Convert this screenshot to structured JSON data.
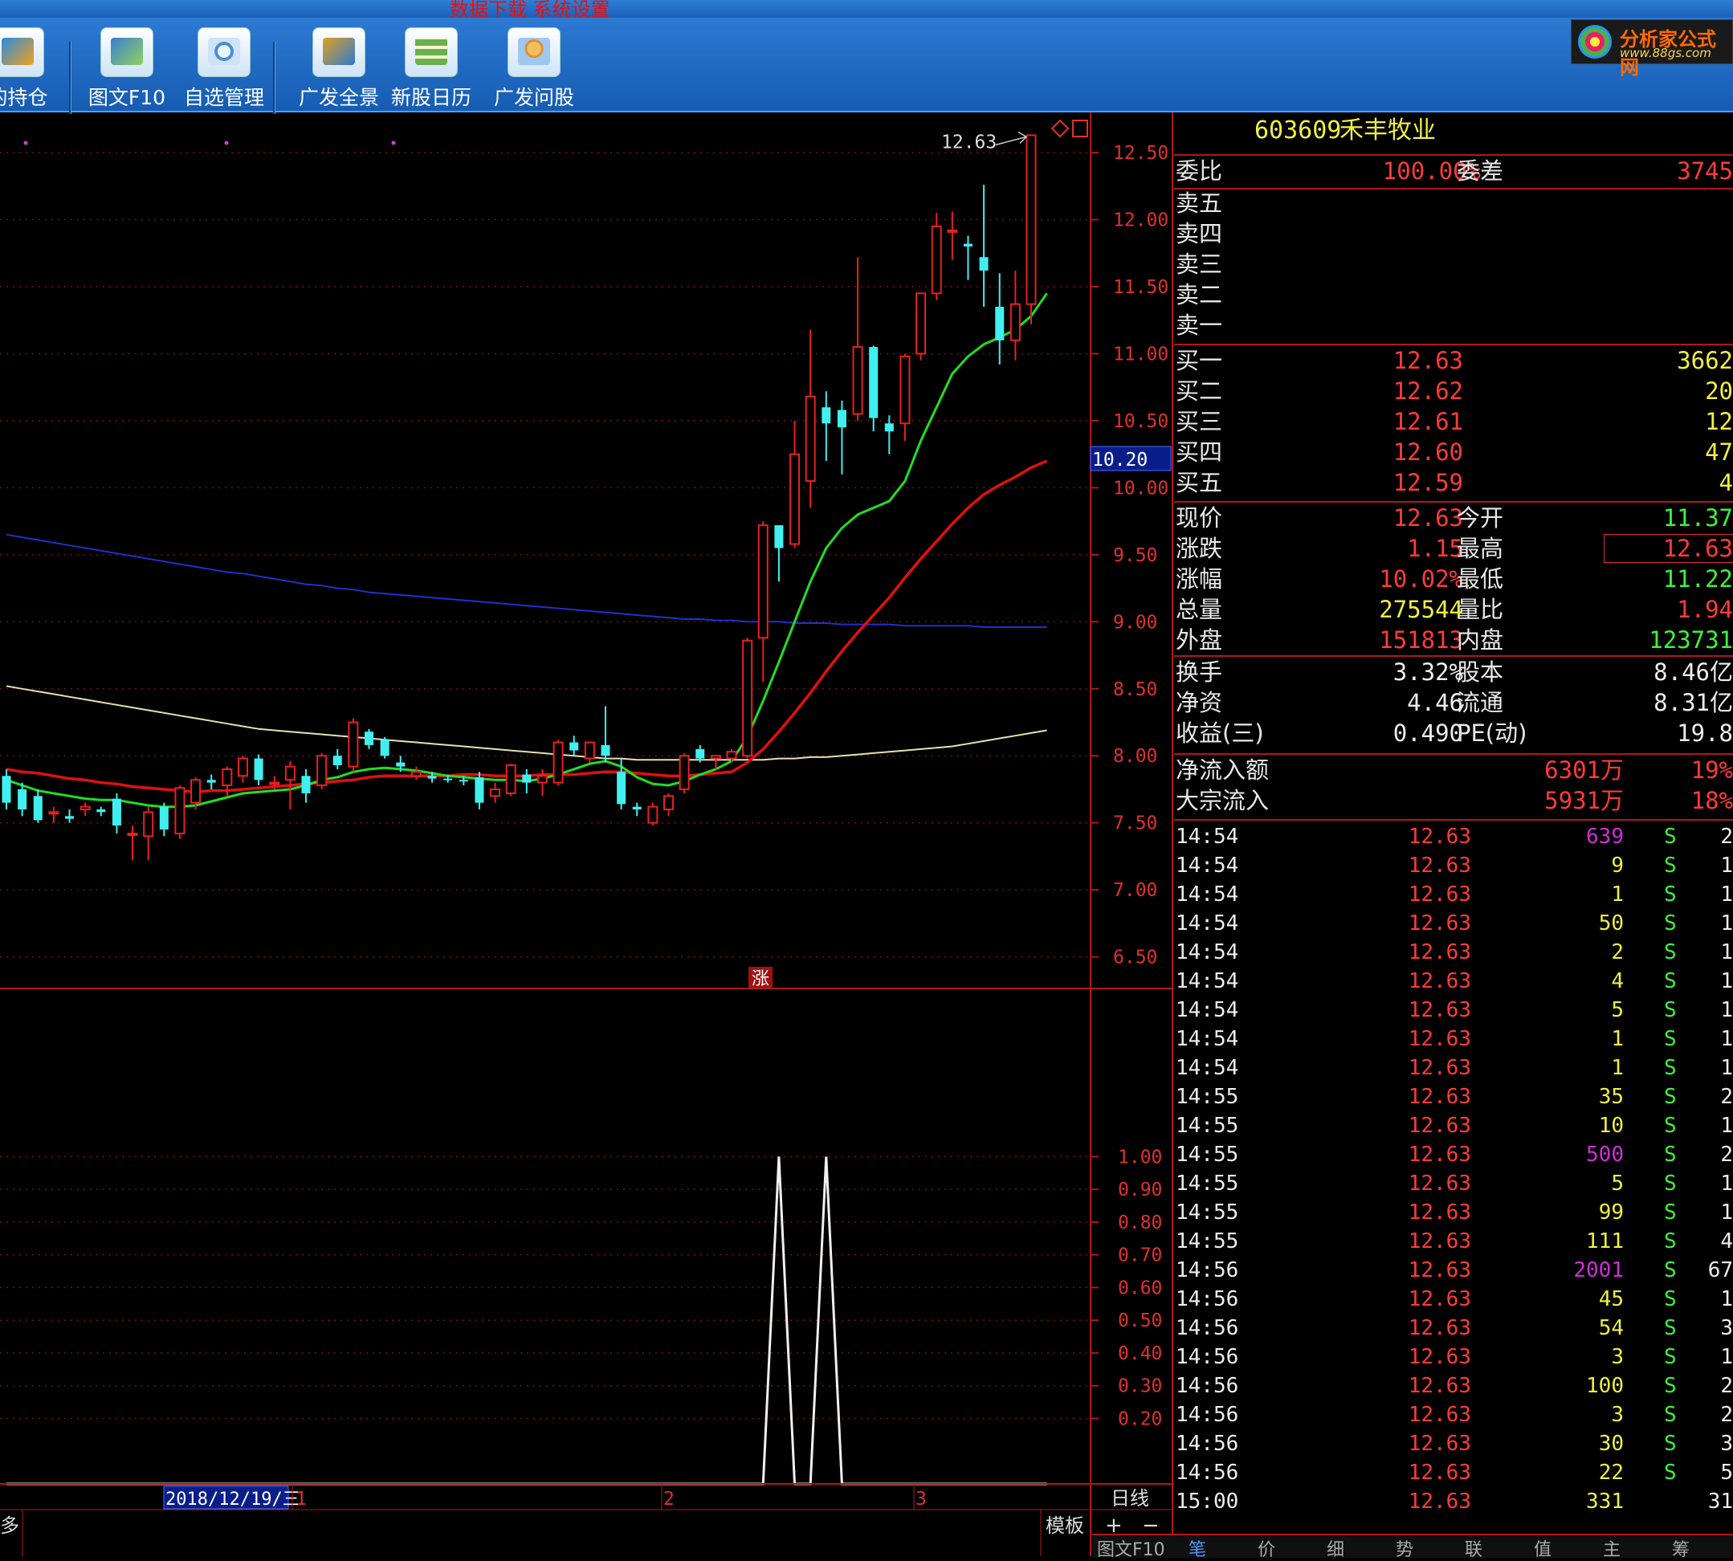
{
  "window": {
    "title_fragment": "数据下载  系统设置"
  },
  "toolbar": {
    "items": [
      {
        "label": "的持仓",
        "icon": "portfolio-icon"
      },
      {
        "label": "图文F10",
        "icon": "f10-icon"
      },
      {
        "label": "自选管理",
        "icon": "watchlist-icon"
      },
      {
        "label": "广发全景",
        "icon": "panorama-icon"
      },
      {
        "label": "新股日历",
        "icon": "calendar-icon"
      },
      {
        "label": "广发问股",
        "icon": "ask-icon"
      }
    ]
  },
  "logo": {
    "name": "分析家公式网",
    "url_text": "www.88gs.com"
  },
  "chart_data": [
    {
      "type": "candlestick",
      "title": "",
      "ylim": [
        6.3,
        12.8
      ],
      "y_ticks": [
        "12.50",
        "12.00",
        "11.50",
        "11.00",
        "10.50",
        "10.00",
        "9.50",
        "9.00",
        "8.50",
        "8.00",
        "7.50",
        "7.00",
        "6.50"
      ],
      "cursor_price": "10.20",
      "max_label": "12.63",
      "marker_text": "涨",
      "candles": [
        {
          "o": 7.85,
          "h": 7.9,
          "l": 7.6,
          "c": 7.65
        },
        {
          "o": 7.75,
          "h": 7.8,
          "l": 7.55,
          "c": 7.6
        },
        {
          "o": 7.7,
          "h": 7.75,
          "l": 7.5,
          "c": 7.52
        },
        {
          "o": 7.58,
          "h": 7.62,
          "l": 7.5,
          "c": 7.58
        },
        {
          "o": 7.55,
          "h": 7.6,
          "l": 7.5,
          "c": 7.53
        },
        {
          "o": 7.6,
          "h": 7.65,
          "l": 7.55,
          "c": 7.62
        },
        {
          "o": 7.6,
          "h": 7.62,
          "l": 7.55,
          "c": 7.58
        },
        {
          "o": 7.68,
          "h": 7.72,
          "l": 7.42,
          "c": 7.48
        },
        {
          "o": 7.42,
          "h": 7.48,
          "l": 7.22,
          "c": 7.42
        },
        {
          "o": 7.4,
          "h": 7.62,
          "l": 7.22,
          "c": 7.58
        },
        {
          "o": 7.62,
          "h": 7.65,
          "l": 7.4,
          "c": 7.45
        },
        {
          "o": 7.42,
          "h": 7.78,
          "l": 7.38,
          "c": 7.76
        },
        {
          "o": 7.65,
          "h": 7.84,
          "l": 7.6,
          "c": 7.82
        },
        {
          "o": 7.82,
          "h": 7.86,
          "l": 7.75,
          "c": 7.8
        },
        {
          "o": 7.78,
          "h": 7.92,
          "l": 7.7,
          "c": 7.9
        },
        {
          "o": 7.85,
          "h": 8.0,
          "l": 7.8,
          "c": 7.98
        },
        {
          "o": 7.98,
          "h": 8.01,
          "l": 7.78,
          "c": 7.82
        },
        {
          "o": 7.8,
          "h": 7.85,
          "l": 7.75,
          "c": 7.8
        },
        {
          "o": 7.82,
          "h": 7.96,
          "l": 7.6,
          "c": 7.92
        },
        {
          "o": 7.85,
          "h": 7.9,
          "l": 7.65,
          "c": 7.72
        },
        {
          "o": 7.78,
          "h": 8.02,
          "l": 7.75,
          "c": 8.0
        },
        {
          "o": 8.0,
          "h": 8.05,
          "l": 7.9,
          "c": 7.93
        },
        {
          "o": 7.92,
          "h": 8.28,
          "l": 7.88,
          "c": 8.25
        },
        {
          "o": 8.18,
          "h": 8.2,
          "l": 8.05,
          "c": 8.08
        },
        {
          "o": 8.12,
          "h": 8.14,
          "l": 7.98,
          "c": 8.0
        },
        {
          "o": 7.95,
          "h": 8.0,
          "l": 7.88,
          "c": 7.92
        },
        {
          "o": 7.85,
          "h": 7.92,
          "l": 7.82,
          "c": 7.88
        },
        {
          "o": 7.85,
          "h": 7.88,
          "l": 7.8,
          "c": 7.83
        },
        {
          "o": 7.83,
          "h": 7.86,
          "l": 7.8,
          "c": 7.82
        },
        {
          "o": 7.82,
          "h": 7.85,
          "l": 7.78,
          "c": 7.81
        },
        {
          "o": 7.84,
          "h": 7.88,
          "l": 7.6,
          "c": 7.65
        },
        {
          "o": 7.7,
          "h": 7.8,
          "l": 7.65,
          "c": 7.75
        },
        {
          "o": 7.72,
          "h": 7.94,
          "l": 7.7,
          "c": 7.93
        },
        {
          "o": 7.86,
          "h": 7.9,
          "l": 7.72,
          "c": 7.8
        },
        {
          "o": 7.8,
          "h": 7.9,
          "l": 7.7,
          "c": 7.85
        },
        {
          "o": 7.8,
          "h": 8.12,
          "l": 7.78,
          "c": 8.1
        },
        {
          "o": 8.1,
          "h": 8.15,
          "l": 8.0,
          "c": 8.04
        },
        {
          "o": 7.98,
          "h": 8.1,
          "l": 7.95,
          "c": 8.1
        },
        {
          "o": 8.08,
          "h": 8.37,
          "l": 7.95,
          "c": 8.0
        },
        {
          "o": 7.88,
          "h": 7.98,
          "l": 7.6,
          "c": 7.64
        },
        {
          "o": 7.62,
          "h": 7.65,
          "l": 7.55,
          "c": 7.6
        },
        {
          "o": 7.5,
          "h": 7.65,
          "l": 7.48,
          "c": 7.62
        },
        {
          "o": 7.6,
          "h": 7.72,
          "l": 7.55,
          "c": 7.7
        },
        {
          "o": 7.75,
          "h": 8.02,
          "l": 7.72,
          "c": 8.0
        },
        {
          "o": 8.05,
          "h": 8.08,
          "l": 7.95,
          "c": 7.98
        },
        {
          "o": 7.98,
          "h": 8.0,
          "l": 7.9,
          "c": 8.0
        },
        {
          "o": 7.98,
          "h": 8.05,
          "l": 7.95,
          "c": 8.03
        },
        {
          "o": 8.0,
          "h": 8.88,
          "l": 7.98,
          "c": 8.86
        },
        {
          "o": 8.88,
          "h": 9.75,
          "l": 8.55,
          "c": 9.72
        },
        {
          "o": 9.72,
          "h": 9.72,
          "l": 9.3,
          "c": 9.55
        },
        {
          "o": 9.58,
          "h": 10.5,
          "l": 9.55,
          "c": 10.25
        },
        {
          "o": 10.05,
          "h": 11.18,
          "l": 9.85,
          "c": 10.68
        },
        {
          "o": 10.6,
          "h": 10.72,
          "l": 10.2,
          "c": 10.48
        },
        {
          "o": 10.58,
          "h": 10.65,
          "l": 10.1,
          "c": 10.45
        },
        {
          "o": 10.55,
          "h": 11.72,
          "l": 10.5,
          "c": 11.05
        },
        {
          "o": 11.05,
          "h": 11.06,
          "l": 10.42,
          "c": 10.52
        },
        {
          "o": 10.48,
          "h": 10.54,
          "l": 10.25,
          "c": 10.42
        },
        {
          "o": 10.48,
          "h": 11.0,
          "l": 10.35,
          "c": 10.98
        },
        {
          "o": 11.0,
          "h": 11.45,
          "l": 10.95,
          "c": 11.45
        },
        {
          "o": 11.45,
          "h": 12.05,
          "l": 11.4,
          "c": 11.95
        },
        {
          "o": 11.92,
          "h": 12.06,
          "l": 11.7,
          "c": 11.92
        },
        {
          "o": 11.82,
          "h": 11.88,
          "l": 11.55,
          "c": 11.8
        },
        {
          "o": 11.72,
          "h": 12.26,
          "l": 11.35,
          "c": 11.62
        },
        {
          "o": 11.35,
          "h": 11.6,
          "l": 10.92,
          "c": 11.1
        },
        {
          "o": 11.1,
          "h": 11.62,
          "l": 10.95,
          "c": 11.37
        },
        {
          "o": 11.37,
          "h": 12.63,
          "l": 11.22,
          "c": 12.63
        }
      ],
      "ma_green": [
        7.82,
        7.78,
        7.74,
        7.72,
        7.7,
        7.68,
        7.67,
        7.67,
        7.65,
        7.63,
        7.62,
        7.62,
        7.63,
        7.66,
        7.69,
        7.72,
        7.73,
        7.74,
        7.75,
        7.78,
        7.82,
        7.84,
        7.88,
        7.9,
        7.91,
        7.9,
        7.89,
        7.87,
        7.85,
        7.84,
        7.83,
        7.82,
        7.82,
        7.81,
        7.83,
        7.86,
        7.9,
        7.94,
        7.96,
        7.92,
        7.84,
        7.79,
        7.78,
        7.81,
        7.86,
        7.9,
        7.96,
        8.14,
        8.41,
        8.7,
        9.0,
        9.3,
        9.55,
        9.7,
        9.8,
        9.85,
        9.9,
        10.05,
        10.35,
        10.6,
        10.85,
        10.98,
        11.07,
        11.12,
        11.18,
        11.28,
        11.45
      ],
      "ma_red": [
        7.9,
        7.88,
        7.87,
        7.85,
        7.83,
        7.82,
        7.8,
        7.79,
        7.77,
        7.76,
        7.75,
        7.74,
        7.73,
        7.74,
        7.74,
        7.75,
        7.76,
        7.77,
        7.78,
        7.79,
        7.8,
        7.81,
        7.82,
        7.84,
        7.85,
        7.85,
        7.85,
        7.85,
        7.85,
        7.86,
        7.86,
        7.85,
        7.85,
        7.85,
        7.86,
        7.86,
        7.86,
        7.87,
        7.88,
        7.88,
        7.87,
        7.86,
        7.85,
        7.85,
        7.86,
        7.87,
        7.88,
        7.95,
        8.05,
        8.18,
        8.32,
        8.47,
        8.63,
        8.78,
        8.92,
        9.05,
        9.18,
        9.33,
        9.47,
        9.6,
        9.73,
        9.85,
        9.95,
        10.02,
        10.08,
        10.15,
        10.2
      ],
      "ma_blue": [
        9.65,
        9.63,
        9.61,
        9.59,
        9.57,
        9.55,
        9.53,
        9.51,
        9.49,
        9.47,
        9.45,
        9.43,
        9.41,
        9.39,
        9.37,
        9.36,
        9.34,
        9.32,
        9.3,
        9.28,
        9.27,
        9.25,
        9.24,
        9.22,
        9.21,
        9.2,
        9.19,
        9.18,
        9.17,
        9.16,
        9.15,
        9.14,
        9.13,
        9.12,
        9.11,
        9.1,
        9.09,
        9.08,
        9.07,
        9.06,
        9.05,
        9.04,
        9.03,
        9.02,
        9.02,
        9.01,
        9.01,
        9.0,
        9.0,
        9.0,
        8.99,
        8.99,
        8.99,
        8.98,
        8.98,
        8.98,
        8.98,
        8.97,
        8.97,
        8.97,
        8.97,
        8.97,
        8.96,
        8.96,
        8.96,
        8.96,
        8.96
      ],
      "ma_beige": [
        8.52,
        8.5,
        8.48,
        8.46,
        8.44,
        8.42,
        8.4,
        8.38,
        8.36,
        8.34,
        8.32,
        8.3,
        8.28,
        8.26,
        8.24,
        8.22,
        8.2,
        8.19,
        8.18,
        8.17,
        8.16,
        8.15,
        8.14,
        8.13,
        8.12,
        8.11,
        8.1,
        8.09,
        8.08,
        8.07,
        8.06,
        8.05,
        8.04,
        8.03,
        8.02,
        8.01,
        8.0,
        7.99,
        7.98,
        7.98,
        7.97,
        7.97,
        7.97,
        7.97,
        7.97,
        7.97,
        7.97,
        7.97,
        7.97,
        7.98,
        7.98,
        7.99,
        7.99,
        8.0,
        8.01,
        8.02,
        8.03,
        8.04,
        8.05,
        8.06,
        8.07,
        8.09,
        8.11,
        8.13,
        8.15,
        8.17,
        8.19
      ]
    },
    {
      "type": "line",
      "title": "",
      "ylim": [
        0,
        1.05
      ],
      "y_ticks": [
        "1.00",
        "0.90",
        "0.80",
        "0.70",
        "0.60",
        "0.50",
        "0.40",
        "0.30",
        "0.20"
      ],
      "values_at_candle_index": [
        {
          "i": 0,
          "v": 0
        },
        {
          "i": 48,
          "v": 0
        },
        {
          "i": 49,
          "v": 1
        },
        {
          "i": 50,
          "v": 0
        },
        {
          "i": 51,
          "v": 0
        },
        {
          "i": 52,
          "v": 1
        },
        {
          "i": 53,
          "v": 0
        },
        {
          "i": 66,
          "v": 0
        }
      ]
    }
  ],
  "x_axis": {
    "date_label": "2018/12/19/三",
    "month_marks": [
      "1",
      "2",
      "3"
    ],
    "period": "日线"
  },
  "bottom_bar": {
    "left_text": "多",
    "template_label": "模板",
    "plus": "+",
    "minus": "−"
  },
  "quote": {
    "code": "603609",
    "name": "禾丰牧业",
    "weibi_label": "委比",
    "weibi": "100.00%",
    "weicha_label": "委差",
    "weicha": "3745",
    "sells": [
      {
        "label": "卖五",
        "price": "",
        "vol": ""
      },
      {
        "label": "卖四",
        "price": "",
        "vol": ""
      },
      {
        "label": "卖三",
        "price": "",
        "vol": ""
      },
      {
        "label": "卖二",
        "price": "",
        "vol": ""
      },
      {
        "label": "卖一",
        "price": "",
        "vol": ""
      }
    ],
    "buys": [
      {
        "label": "买一",
        "price": "12.63",
        "vol": "3662"
      },
      {
        "label": "买二",
        "price": "12.62",
        "vol": "20"
      },
      {
        "label": "买三",
        "price": "12.61",
        "vol": "12"
      },
      {
        "label": "买四",
        "price": "12.60",
        "vol": "47"
      },
      {
        "label": "买五",
        "price": "12.59",
        "vol": "4"
      }
    ],
    "stats1": [
      {
        "l1": "现价",
        "v1": "12.63",
        "c1": "red",
        "l2": "今开",
        "v2": "11.37",
        "c2": "grn"
      },
      {
        "l1": "涨跌",
        "v1": "1.15",
        "c1": "red",
        "l2": "最高",
        "v2": "12.63",
        "c2": "red"
      },
      {
        "l1": "涨幅",
        "v1": "10.02%",
        "c1": "red",
        "l2": "最低",
        "v2": "11.22",
        "c2": "grn"
      },
      {
        "l1": "总量",
        "v1": "275544",
        "c1": "yel",
        "l2": "量比",
        "v2": "1.94",
        "c2": "red"
      },
      {
        "l1": "外盘",
        "v1": "151813",
        "c1": "red",
        "l2": "内盘",
        "v2": "123731",
        "c2": "grn"
      }
    ],
    "stats2": [
      {
        "l1": "换手",
        "v1": "3.32%",
        "l2": "股本",
        "v2": "8.46亿"
      },
      {
        "l1": "净资",
        "v1": "4.46",
        "l2": "流通",
        "v2": "8.31亿"
      },
      {
        "l1": "收益(三)",
        "v1": "0.490",
        "l2": "PE(动)",
        "v2": "19.8"
      }
    ],
    "flows": [
      {
        "label": "净流入额",
        "value": "6301万",
        "pct": "19%"
      },
      {
        "label": "大宗流入",
        "value": "5931万",
        "pct": "18%"
      }
    ],
    "ticks": [
      {
        "t": "14:54",
        "p": "12.63",
        "v": "639",
        "c": "mag",
        "s": "S",
        "n": "2"
      },
      {
        "t": "14:54",
        "p": "12.63",
        "v": "9",
        "c": "yel",
        "s": "S",
        "n": "1"
      },
      {
        "t": "14:54",
        "p": "12.63",
        "v": "1",
        "c": "yel",
        "s": "S",
        "n": "1"
      },
      {
        "t": "14:54",
        "p": "12.63",
        "v": "50",
        "c": "yel",
        "s": "S",
        "n": "1"
      },
      {
        "t": "14:54",
        "p": "12.63",
        "v": "2",
        "c": "yel",
        "s": "S",
        "n": "1"
      },
      {
        "t": "14:54",
        "p": "12.63",
        "v": "4",
        "c": "yel",
        "s": "S",
        "n": "1"
      },
      {
        "t": "14:54",
        "p": "12.63",
        "v": "5",
        "c": "yel",
        "s": "S",
        "n": "1"
      },
      {
        "t": "14:54",
        "p": "12.63",
        "v": "1",
        "c": "yel",
        "s": "S",
        "n": "1"
      },
      {
        "t": "14:54",
        "p": "12.63",
        "v": "1",
        "c": "yel",
        "s": "S",
        "n": "1"
      },
      {
        "t": "14:55",
        "p": "12.63",
        "v": "35",
        "c": "yel",
        "s": "S",
        "n": "2"
      },
      {
        "t": "14:55",
        "p": "12.63",
        "v": "10",
        "c": "yel",
        "s": "S",
        "n": "1"
      },
      {
        "t": "14:55",
        "p": "12.63",
        "v": "500",
        "c": "mag",
        "s": "S",
        "n": "2"
      },
      {
        "t": "14:55",
        "p": "12.63",
        "v": "5",
        "c": "yel",
        "s": "S",
        "n": "1"
      },
      {
        "t": "14:55",
        "p": "12.63",
        "v": "99",
        "c": "yel",
        "s": "S",
        "n": "1"
      },
      {
        "t": "14:55",
        "p": "12.63",
        "v": "111",
        "c": "yel",
        "s": "S",
        "n": "4"
      },
      {
        "t": "14:56",
        "p": "12.63",
        "v": "2001",
        "c": "mag",
        "s": "S",
        "n": "67"
      },
      {
        "t": "14:56",
        "p": "12.63",
        "v": "45",
        "c": "yel",
        "s": "S",
        "n": "1"
      },
      {
        "t": "14:56",
        "p": "12.63",
        "v": "54",
        "c": "yel",
        "s": "S",
        "n": "3"
      },
      {
        "t": "14:56",
        "p": "12.63",
        "v": "3",
        "c": "yel",
        "s": "S",
        "n": "1"
      },
      {
        "t": "14:56",
        "p": "12.63",
        "v": "100",
        "c": "yel",
        "s": "S",
        "n": "2"
      },
      {
        "t": "14:56",
        "p": "12.63",
        "v": "3",
        "c": "yel",
        "s": "S",
        "n": "2"
      },
      {
        "t": "14:56",
        "p": "12.63",
        "v": "30",
        "c": "yel",
        "s": "S",
        "n": "3"
      },
      {
        "t": "14:56",
        "p": "12.63",
        "v": "22",
        "c": "yel",
        "s": "S",
        "n": "5"
      },
      {
        "t": "15:00",
        "p": "12.63",
        "v": "331",
        "c": "yel",
        "s": "",
        "n": "31"
      }
    ]
  },
  "bottom_tabs": [
    "图文F10",
    "笔",
    "价",
    "细",
    "势",
    "联",
    "值",
    "主",
    "筹"
  ],
  "colors": {
    "up": "#e82020",
    "down": "#40f0f0",
    "ma_green": "#22dd22",
    "ma_red": "#e01010",
    "ma_blue": "#2030d0",
    "ma_beige": "#e8e0b0",
    "axis": "#b01818"
  }
}
